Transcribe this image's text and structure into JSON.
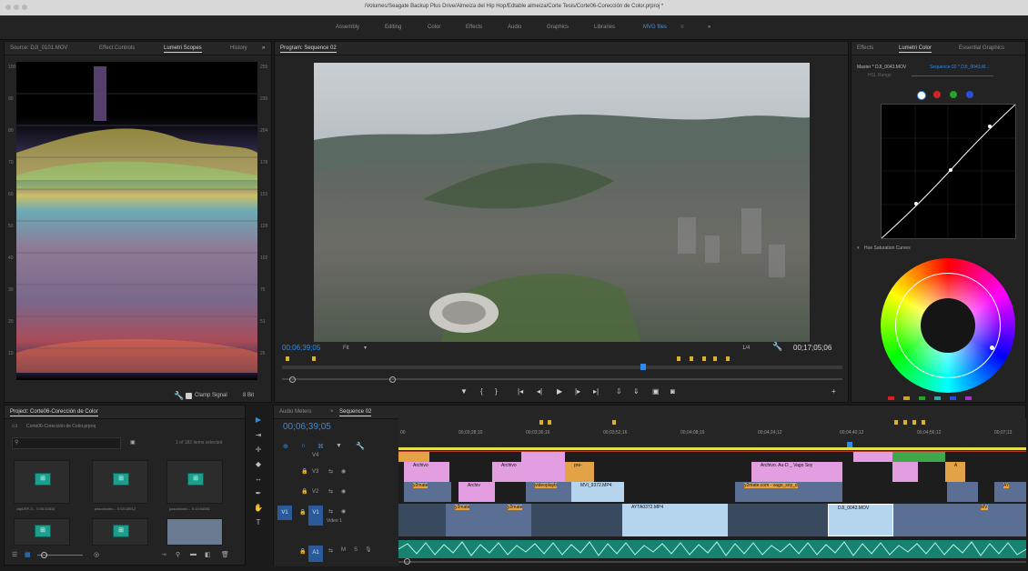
{
  "window": {
    "title": "/Volumes/Seagate Backup Plus Drive/Almeiza del Hip Hop/Edtable almeiza/Corte Tesis/Corte06-Corección de Color.prproj *"
  },
  "workspaces": [
    "Assembly",
    "Editing",
    "Color",
    "Effects",
    "Audio",
    "Graphics",
    "Libraries",
    "MVG files"
  ],
  "source_panel": {
    "tabs": [
      "Source: DJI_0101.MOV",
      "Effect Controls",
      "Lumetri Scopes",
      "History"
    ],
    "scale_left": [
      "100",
      "90",
      "80",
      "70",
      "60",
      "50",
      "40",
      "30",
      "20",
      "10"
    ],
    "scale_right": [
      "255",
      "230",
      "204",
      "178",
      "153",
      "128",
      "102",
      "76",
      "51",
      "26"
    ],
    "clamp_label": "Clamp Signal",
    "bit_label": "8 Bit"
  },
  "program_panel": {
    "tab": "Program: Sequence 02",
    "timecode_current": "00;06;39;05",
    "fit": "Fit",
    "resolution": "1/4",
    "timecode_duration": "00;17;05;06"
  },
  "lumetri_color": {
    "tabs": [
      "Effects",
      "Lumetri Color",
      "Essential Graphics"
    ],
    "master": "Master * DJI_0043.MOV",
    "sequence_link": "Sequence 02 * DJI_0043.M...",
    "hsl_range": "HSL Range",
    "section": "Hue Saturation Curves",
    "curve_channels": [
      "#ffffff",
      "#d12424",
      "#2aa12a",
      "#2b4fd8"
    ],
    "accent": "#2d8ceb"
  },
  "project_panel": {
    "title": "Project: Corte06-Corección de Color",
    "file": "Corte06-Corección de Color.prproj",
    "search_placeholder": "",
    "selection": "1 of 182 items selected",
    "items": [
      {
        "name": "clipDRF-3...",
        "dur": "0:05:10814"
      },
      {
        "name": "pasoduvelo...",
        "dur": "0:03:15912"
      },
      {
        "name": "pasoduvelo...",
        "dur": "0:10:04081"
      },
      {
        "name": "",
        "dur": ""
      },
      {
        "name": "",
        "dur": ""
      },
      {
        "name": "",
        "dur": ""
      }
    ]
  },
  "timeline": {
    "tabs": [
      "Audio Meters",
      "Sequence 02"
    ],
    "timecode": "00;06;39;05",
    "ruler": [
      "00",
      "00;03;28;10",
      "00;03;36;16",
      "00;03;52;16",
      "00;04;08;16",
      "00;04;24;12",
      "00;04;40;12",
      "00;04;56;12",
      "00;07;13"
    ],
    "tracks": {
      "v4": "V4",
      "v3": "V3",
      "v2": "V2",
      "v1": "V1",
      "video1": "Video 1",
      "a1": "A1"
    },
    "clips": {
      "archivo1": "Archivo",
      "archivo2": "Archivo",
      "pre": "pre-",
      "archivo_au": "Archivo. Au-D _ Vago Soy",
      "y2mate1": "y2mate",
      "archiv": "Archiv",
      "videoplayb": "videoplayb",
      "mvi": "MVI_9372.MP4",
      "y2mate_com": "y2mate.com - vago_soy_d",
      "y2mate2": "y2mate",
      "y2mate3": "y2mate",
      "ayta1": "AYTA0372.MP4",
      "dji": "DJI_0043.MOV",
      "a_label": "A",
      "ay": "AY",
      "mv": "MV"
    }
  }
}
